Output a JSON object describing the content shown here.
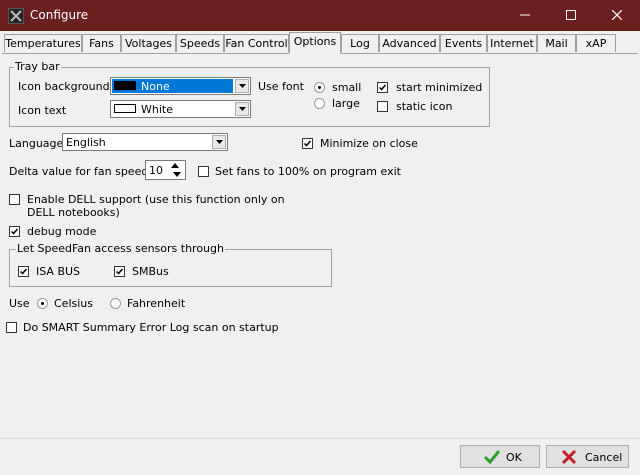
{
  "window": {
    "title": "Configure"
  },
  "tabs": [
    {
      "label": "Temperatures"
    },
    {
      "label": "Fans"
    },
    {
      "label": "Voltages"
    },
    {
      "label": "Speeds"
    },
    {
      "label": "Fan Control"
    },
    {
      "label": "Options"
    },
    {
      "label": "Log"
    },
    {
      "label": "Advanced"
    },
    {
      "label": "Events"
    },
    {
      "label": "Internet"
    },
    {
      "label": "Mail"
    },
    {
      "label": "xAP"
    }
  ],
  "active_tab": "Options",
  "tray_bar": {
    "group_label": "Tray bar",
    "icon_background_label": "Icon background",
    "icon_background_value": "None",
    "icon_background_swatch": "#000000",
    "icon_text_label": "Icon text",
    "icon_text_value": "White",
    "icon_text_swatch": "#ffffff",
    "use_font_label": "Use font",
    "font_small_label": "small",
    "font_large_label": "large",
    "font_selected": "small",
    "start_minimized_label": "start minimized",
    "start_minimized_checked": true,
    "static_icon_label": "static icon",
    "static_icon_checked": false
  },
  "language": {
    "label": "Language",
    "value": "English"
  },
  "minimize_on_close": {
    "label": "Minimize on close",
    "checked": true
  },
  "delta": {
    "label": "Delta value for fan speeds",
    "value": "10"
  },
  "set_fans_100": {
    "label": "Set fans to 100% on program exit",
    "checked": false
  },
  "dell_support": {
    "line1": "Enable DELL support (use this function only on",
    "line2": "DELL notebooks)",
    "checked": false
  },
  "debug_mode": {
    "label": "debug mode",
    "checked": true
  },
  "sensors": {
    "group_label": "Let SpeedFan access sensors through",
    "isa_label": "ISA BUS",
    "isa_checked": true,
    "smbus_label": "SMBus",
    "smbus_checked": true
  },
  "units": {
    "use_label": "Use",
    "celsius_label": "Celsius",
    "fahrenheit_label": "Fahrenheit",
    "selected": "Celsius"
  },
  "smart_scan": {
    "label": "Do SMART Summary Error Log scan on startup",
    "checked": false
  },
  "buttons": {
    "ok_label": "OK",
    "cancel_label": "Cancel"
  },
  "colors": {
    "titlebar": "#6b1f1f",
    "selection": "#0078d7",
    "ok_check": "#2e9e2e",
    "cancel_x": "#c41e1e"
  }
}
